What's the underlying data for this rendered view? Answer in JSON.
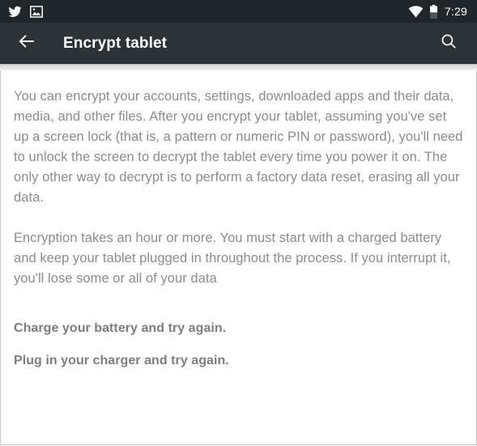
{
  "status_bar": {
    "icons_left": [
      "twitter-bird-icon",
      "screenshot-image-icon"
    ],
    "icons_right": [
      "wifi-icon",
      "battery-icon"
    ],
    "time": "7:29",
    "background_color": "#21262a",
    "foreground_color": "#ffffff"
  },
  "toolbar": {
    "back_icon": "back-arrow-icon",
    "title": "Encrypt tablet",
    "search_icon": "search-icon",
    "background_color": "#2b3339",
    "title_color": "#ffffff"
  },
  "content": {
    "background_color": "#ffffff",
    "body_text_color": "#8c8c8c",
    "emphasis_text_color": "#7e7e7e",
    "paragraphs": [
      "You can encrypt your accounts, settings, downloaded apps and their data, media, and other files. After you encrypt your tablet, assuming you've set up a screen lock (that is, a pattern or numeric PIN or password), you'll need to unlock the screen to decrypt the tablet every time you power it on. The only other way to decrypt is to perform a factory data reset, erasing all your data.",
      "Encryption takes an hour or more. You must start with a charged battery and keep your tablet plugged in throughout the process. If you interrupt it, you'll lose some or all of your data"
    ],
    "warnings": [
      "Charge your battery and try again.",
      "Plug in your charger and try again."
    ]
  }
}
